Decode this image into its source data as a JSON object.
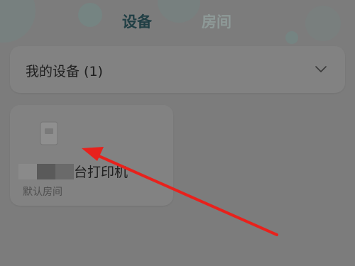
{
  "header": {
    "tabs": [
      {
        "label": "设备",
        "active": true
      },
      {
        "label": "房间",
        "active": false
      }
    ]
  },
  "devices_section": {
    "title": "我的设备 (1)",
    "expand_icon": "chevron-down-icon"
  },
  "device_card": {
    "icon": "printer-icon",
    "name_visible_suffix": "台打印机",
    "room": "默认房间"
  },
  "annotation": {
    "color": "#e8211c"
  }
}
